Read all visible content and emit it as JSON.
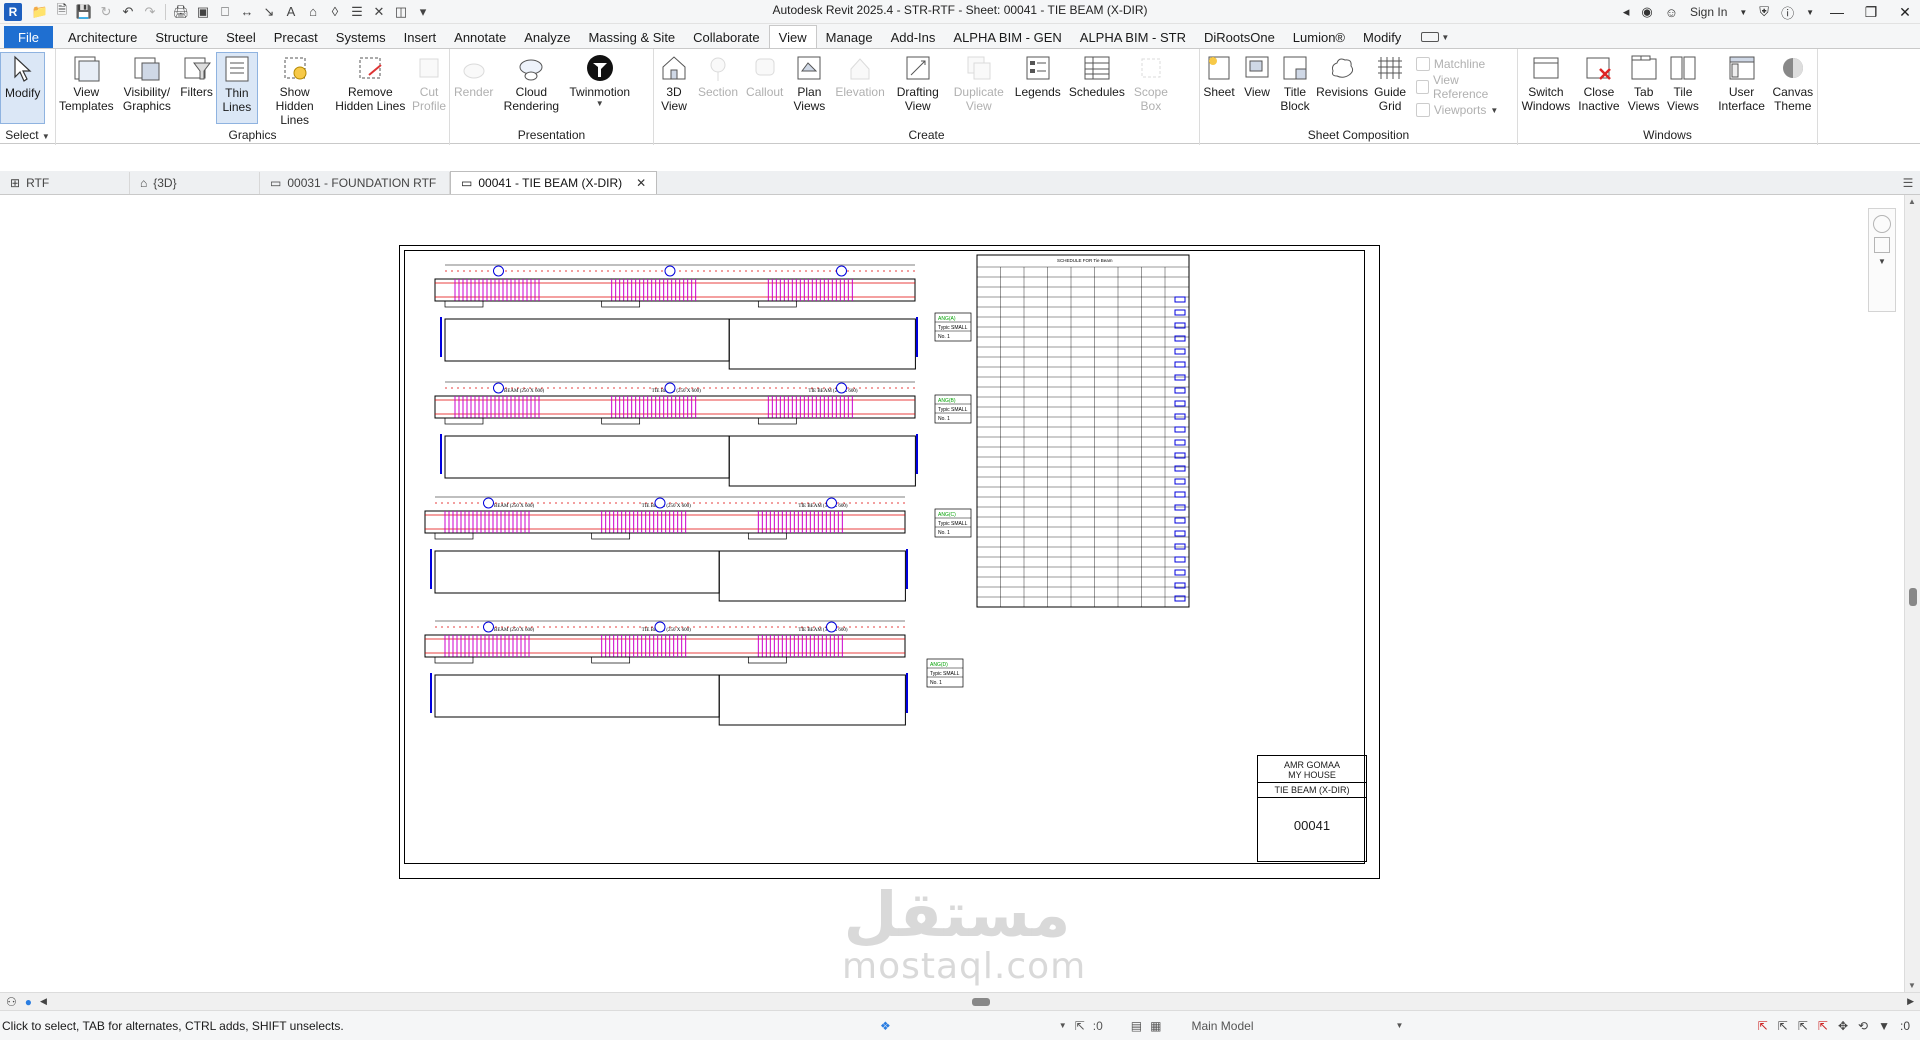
{
  "titlebar": {
    "app_badge": "R",
    "title": "Autodesk Revit 2025.4 - STR-RTF - Sheet: 00041 - TIE BEAM (X-DIR)",
    "sign_in": "Sign In"
  },
  "ribbon_tabs": [
    "File",
    "Architecture",
    "Structure",
    "Steel",
    "Precast",
    "Systems",
    "Insert",
    "Annotate",
    "Analyze",
    "Massing & Site",
    "Collaborate",
    "View",
    "Manage",
    "Add-Ins",
    "ALPHA BIM - GEN",
    "ALPHA BIM - STR",
    "DiRootsOne",
    "Lumion®",
    "Modify"
  ],
  "ribbon": {
    "select_panel": {
      "title": "Select",
      "modify": "Modify"
    },
    "graphics_panel": {
      "title": "Graphics",
      "view_templates": "View Templates",
      "visibility_graphics": "Visibility/ Graphics",
      "filters": "Filters",
      "thin_lines": "Thin Lines",
      "show_hidden_lines": "Show Hidden Lines",
      "remove_hidden_lines": "Remove Hidden Lines",
      "cut_profile": "Cut Profile"
    },
    "presentation_panel": {
      "title": "Presentation",
      "render": "Render",
      "cloud_rendering": "Cloud Rendering",
      "twinmotion": "Twinmotion"
    },
    "create_panel": {
      "title": "Create",
      "view_3d": "3D View",
      "section": "Section",
      "callout": "Callout",
      "plan_views": "Plan Views",
      "elevation": "Elevation",
      "drafting_view": "Drafting View",
      "duplicate_view": "Duplicate View",
      "legends": "Legends",
      "schedules": "Schedules",
      "scope_box": "Scope Box"
    },
    "sheet_panel": {
      "title": "Sheet Composition",
      "sheet": "Sheet",
      "view": "View",
      "title_block": "Title Block",
      "revisions": "Revisions",
      "guide_grid": "Guide Grid",
      "matchline": "Matchline",
      "view_reference": "View Reference",
      "viewports": "Viewports"
    },
    "windows_panel": {
      "title": "Windows",
      "switch_windows": "Switch Windows",
      "close_inactive": "Close Inactive",
      "tab_views": "Tab Views",
      "tile_views": "Tile Views",
      "user_interface": "User Interface",
      "canvas_theme": "Canvas Theme"
    }
  },
  "view_tabs": [
    {
      "label": "RTF",
      "icon": "floor-plan-icon"
    },
    {
      "label": "{3D}",
      "icon": "house-3d-icon"
    },
    {
      "label": "00031 - FOUNDATION RTF",
      "icon": "sheet-icon"
    },
    {
      "label": "00041 - TIE BEAM (X-DIR)",
      "icon": "sheet-icon"
    }
  ],
  "sheet": {
    "owner": "AMR GOMAA",
    "project": "MY HOUSE",
    "sheet_name": "TIE BEAM (X-DIR)",
    "sheet_number": "00041",
    "schedule_title": "SCHEDULE FOR Tie Beam",
    "beam_labels": [
      "TIE BEAM (250 X 600)",
      "TIE BEAM (250 X 600)",
      "TIE BEAM (250 X 600)",
      "TIE BEAM (250 X 600)",
      "TIE BEAM (250 X 600)",
      "TIE BEAM (350 X 600)",
      "TIE BEAM (250 X 600)",
      "TIE BEAM (250 X 600)",
      "TIE BEAM (350 X 600)"
    ],
    "tags": [
      {
        "axis": "ANG(A)",
        "typical": "SMALL",
        "no": "1"
      },
      {
        "axis": "ANG(B)",
        "typical": "SMALL",
        "no": "1"
      },
      {
        "axis": "ANG(C)",
        "typical": "SMALL",
        "no": "1"
      },
      {
        "axis": "ANG(D)",
        "typical": "SMALL",
        "no": "1"
      }
    ]
  },
  "statusbar": {
    "message": "Click to select, TAB for alternates, CTRL adds, SHIFT unselects.",
    "coord": ":0",
    "model": "Main Model",
    "filter_count": ":0"
  },
  "watermark": {
    "arabic": "مستقل",
    "latin": "mostaql.com"
  },
  "colors": {
    "file_tab": "#1f6fd1",
    "rebar_magenta": "#cc00cc",
    "dim_red": "#e00000",
    "tag_green": "#00a000",
    "dim_blue": "#0000dd"
  }
}
